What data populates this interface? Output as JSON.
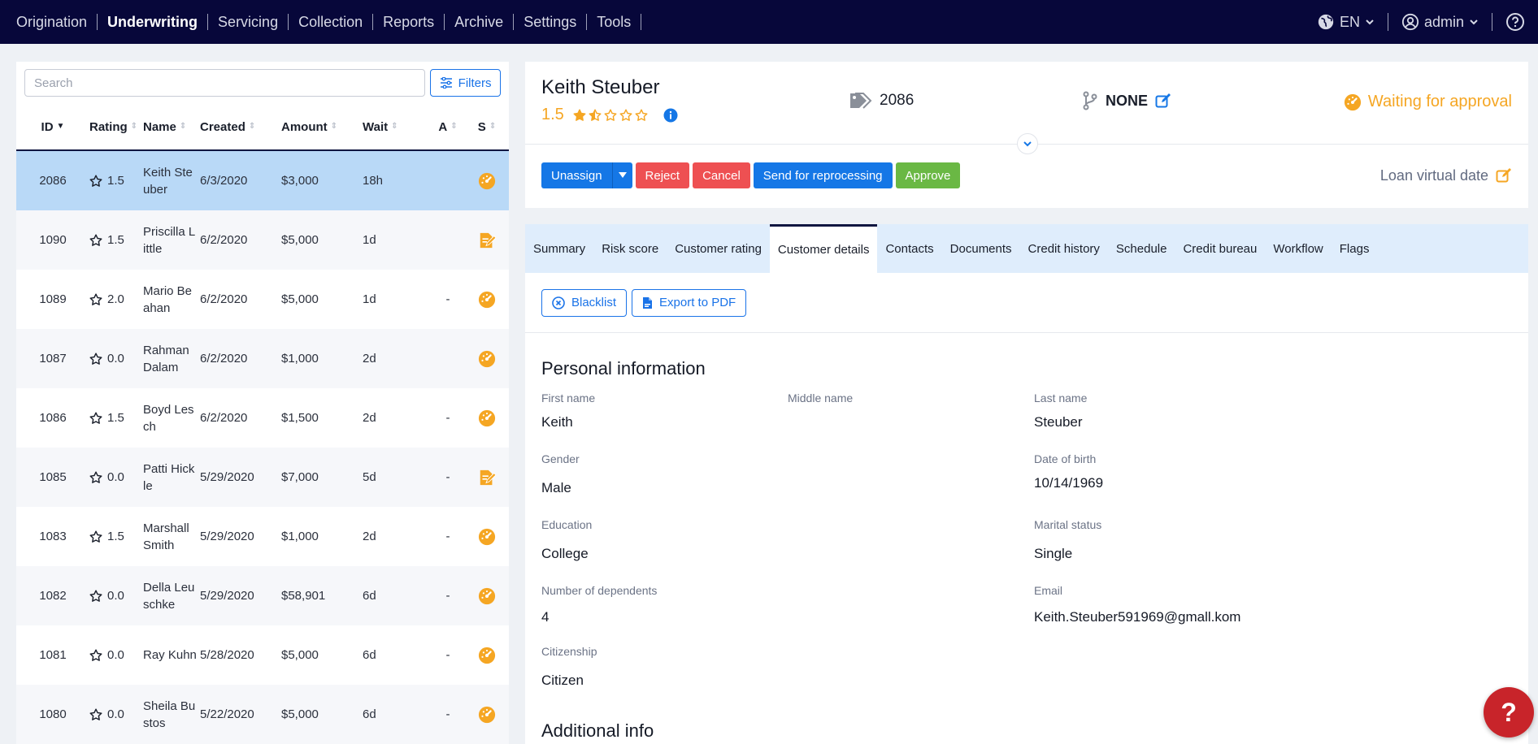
{
  "nav": {
    "items": [
      {
        "label": "Origination",
        "active": false
      },
      {
        "label": "Underwriting",
        "active": true
      },
      {
        "label": "Servicing",
        "active": false
      },
      {
        "label": "Collection",
        "active": false
      },
      {
        "label": "Reports",
        "active": false
      },
      {
        "label": "Archive",
        "active": false
      },
      {
        "label": "Settings",
        "active": false
      },
      {
        "label": "Tools",
        "active": false
      }
    ],
    "language": "EN",
    "user": "admin"
  },
  "list": {
    "search_placeholder": "Search",
    "filters_label": "Filters",
    "headers": {
      "id": "ID",
      "rating": "Rating",
      "name": "Name",
      "created": "Created",
      "amount": "Amount",
      "wait": "Wait",
      "a": "A",
      "s": "S"
    },
    "rows": [
      {
        "id": "2086",
        "rating": "1.5",
        "name": "Keith Steuber",
        "created": "6/3/2020",
        "amount": "$3,000",
        "wait": "18h",
        "a": "",
        "status": "gauge",
        "selected": true
      },
      {
        "id": "1090",
        "rating": "1.5",
        "name": "Priscilla Little",
        "created": "6/2/2020",
        "amount": "$5,000",
        "wait": "1d",
        "a": "",
        "status": "edit",
        "selected": false
      },
      {
        "id": "1089",
        "rating": "2.0",
        "name": "Mario Beahan",
        "created": "6/2/2020",
        "amount": "$5,000",
        "wait": "1d",
        "a": "-",
        "status": "gauge",
        "selected": false
      },
      {
        "id": "1087",
        "rating": "0.0",
        "name": "Rahman Dalam",
        "created": "6/2/2020",
        "amount": "$1,000",
        "wait": "2d",
        "a": "",
        "status": "gauge",
        "selected": false
      },
      {
        "id": "1086",
        "rating": "1.5",
        "name": "Boyd Lesch",
        "created": "6/2/2020",
        "amount": "$1,500",
        "wait": "2d",
        "a": "-",
        "status": "gauge",
        "selected": false
      },
      {
        "id": "1085",
        "rating": "0.0",
        "name": "Patti Hickle",
        "created": "5/29/2020",
        "amount": "$7,000",
        "wait": "5d",
        "a": "-",
        "status": "edit",
        "selected": false
      },
      {
        "id": "1083",
        "rating": "1.5",
        "name": "Marshall Smith",
        "created": "5/29/2020",
        "amount": "$1,000",
        "wait": "2d",
        "a": "-",
        "status": "gauge",
        "selected": false
      },
      {
        "id": "1082",
        "rating": "0.0",
        "name": "Della Leuschke",
        "created": "5/29/2020",
        "amount": "$58,901",
        "wait": "6d",
        "a": "-",
        "status": "gauge",
        "selected": false
      },
      {
        "id": "1081",
        "rating": "0.0",
        "name": "Ray Kuhn",
        "created": "5/28/2020",
        "amount": "$5,000",
        "wait": "6d",
        "a": "-",
        "status": "gauge",
        "selected": false
      },
      {
        "id": "1080",
        "rating": "0.0",
        "name": "Sheila Bustos",
        "created": "5/22/2020",
        "amount": "$5,000",
        "wait": "6d",
        "a": "-",
        "status": "gauge",
        "selected": false
      }
    ]
  },
  "detail": {
    "name": "Keith Steuber",
    "rating": "1.5",
    "stars": 1.5,
    "loan_id": "2086",
    "branch": "NONE",
    "status": "Waiting for approval",
    "loan_virtual_date": "Loan virtual date",
    "actions": {
      "unassign": "Unassign",
      "reject": "Reject",
      "cancel": "Cancel",
      "reprocess": "Send for reprocessing",
      "approve": "Approve"
    }
  },
  "tabs": [
    "Summary",
    "Risk score",
    "Customer rating",
    "Customer details",
    "Contacts",
    "Documents",
    "Credit history",
    "Schedule",
    "Credit bureau",
    "Workflow",
    "Flags"
  ],
  "active_tab": "Customer details",
  "tab_actions": {
    "blacklist": "Blacklist",
    "export": "Export to PDF"
  },
  "personal": {
    "title": "Personal information",
    "first_name_label": "First name",
    "first_name": "Keith",
    "middle_name_label": "Middle name",
    "middle_name": "",
    "last_name_label": "Last name",
    "last_name": "Steuber",
    "gender_label": "Gender",
    "gender": "Male",
    "dob_label": "Date of birth",
    "dob": "10/14/1969",
    "education_label": "Education",
    "education": "College",
    "marital_label": "Marital status",
    "marital": "Single",
    "dependents_label": "Number of dependents",
    "dependents": "4",
    "email_label": "Email",
    "email": "Keith.Steuber591969@gmall.kom",
    "citizenship_label": "Citizenship",
    "citizenship": "Citizen"
  },
  "additional": {
    "title": "Additional info"
  },
  "help_fab": "?",
  "colors": {
    "nav_bg": "#07073a",
    "accent": "#1577e6",
    "warning": "#f5a623",
    "danger": "#ee5052",
    "success": "#6ab844",
    "selected_row": "#b9d9f7",
    "tab_bar": "#dfedfc"
  }
}
